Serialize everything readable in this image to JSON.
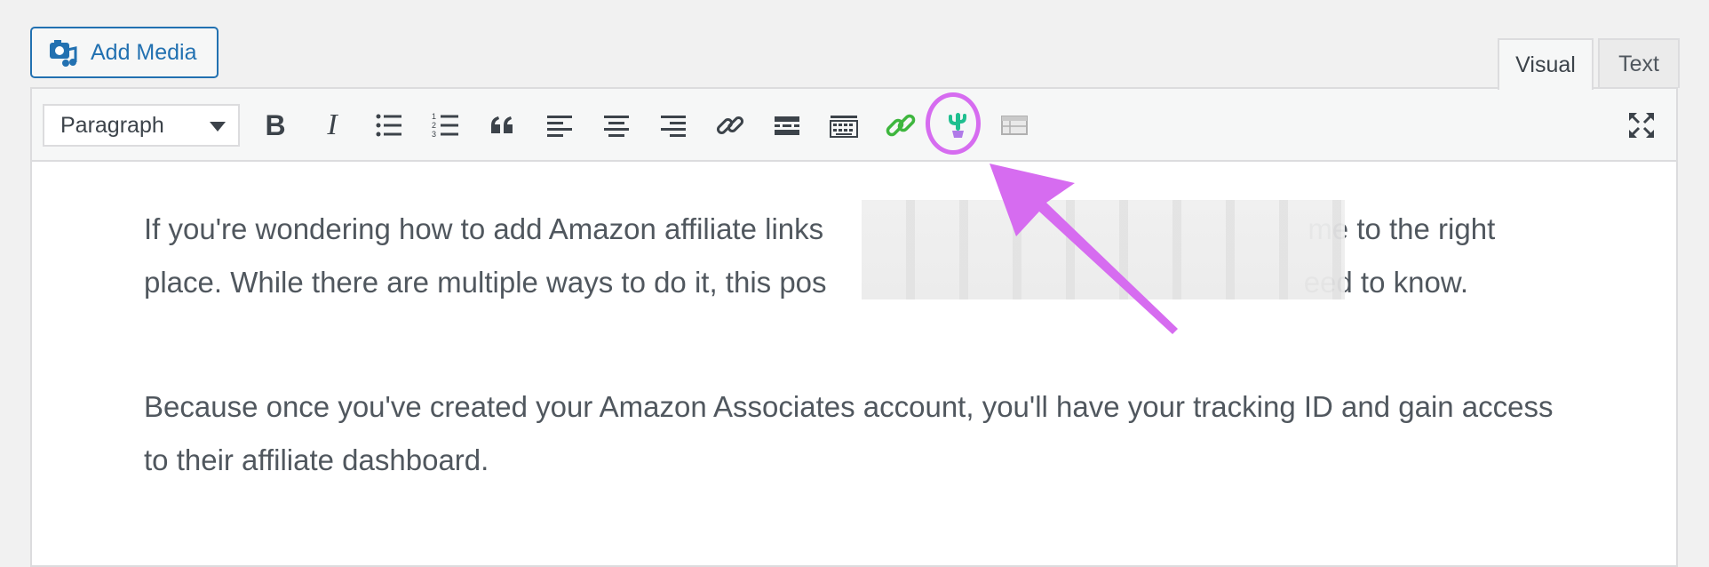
{
  "media": {
    "add_media_label": "Add Media"
  },
  "tabs": {
    "visual": "Visual",
    "text": "Text"
  },
  "toolbar": {
    "format_value": "Paragraph",
    "bold": "B",
    "italic": "I"
  },
  "content": {
    "para1_a": "If you're wondering how to add Amazon affiliate links",
    "para1_b": "me to the right",
    "para1_c": "place. While there are multiple ways to do it, this pos",
    "para1_d": "eed to know.",
    "para2": "Because once you've created your Amazon Associates account, you'll have your tracking ID and gain access to their affiliate dashboard."
  },
  "colors": {
    "accent": "#2271b1",
    "highlight": "#d66cf0",
    "plugin_link_icon": "#3eb63e",
    "plugin_cactus_icon": "#1fbf8f"
  },
  "icons": [
    "camera-music-icon",
    "bold-icon",
    "italic-icon",
    "bullet-list-icon",
    "numbered-list-icon",
    "blockquote-icon",
    "align-left-icon",
    "align-center-icon",
    "align-right-icon",
    "link-icon",
    "read-more-icon",
    "toolbar-toggle-icon",
    "green-link-icon",
    "cactus-icon",
    "table-icon",
    "fullscreen-icon"
  ]
}
